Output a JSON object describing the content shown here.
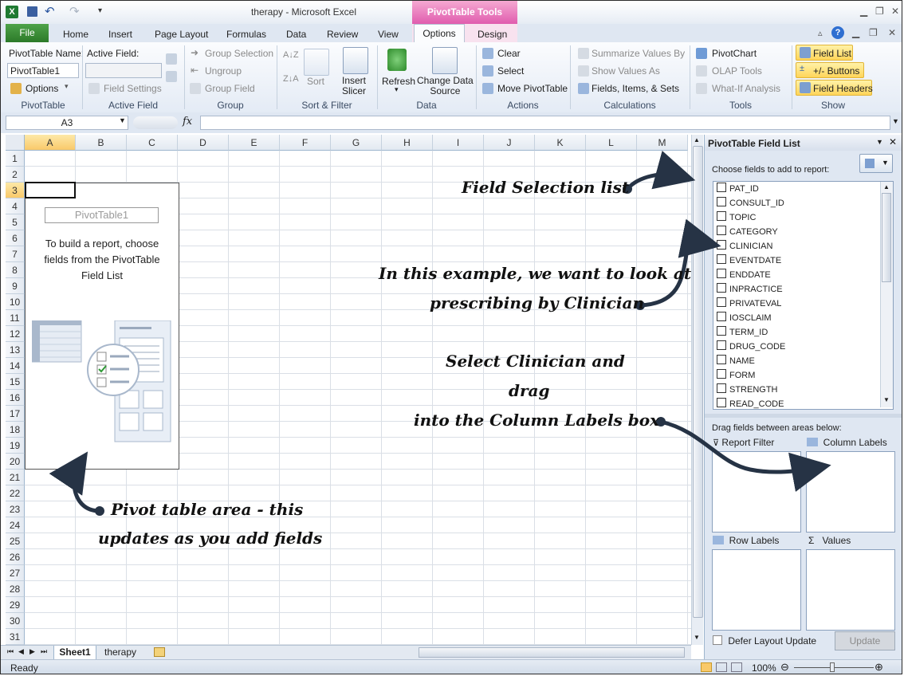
{
  "window": {
    "title": "therapy -  Microsoft Excel",
    "contextual_header": "PivotTable Tools"
  },
  "tabs": {
    "file": "File",
    "home": "Home",
    "insert": "Insert",
    "page_layout": "Page Layout",
    "formulas": "Formulas",
    "data": "Data",
    "review": "Review",
    "view": "View",
    "options": "Options",
    "design": "Design"
  },
  "ribbon": {
    "pivottable": {
      "name_label": "PivotTable Name:",
      "name_value": "PivotTable1",
      "options": "Options",
      "group": "PivotTable"
    },
    "active_field": {
      "label": "Active Field:",
      "field_settings": "Field Settings",
      "group": "Active Field"
    },
    "group": {
      "selection": "Group Selection",
      "ungroup": "Ungroup",
      "group_field": "Group Field",
      "group": "Group"
    },
    "sort_filter": {
      "sort": "Sort",
      "insert_slicer": "Insert\nSlicer",
      "group": "Sort & Filter"
    },
    "data": {
      "refresh": "Refresh",
      "change_source": "Change Data\nSource",
      "group": "Data"
    },
    "actions": {
      "clear": "Clear",
      "select": "Select",
      "move": "Move PivotTable",
      "group": "Actions"
    },
    "calculations": {
      "summarize": "Summarize Values By",
      "show_values": "Show Values As",
      "fields_items": "Fields, Items, & Sets",
      "group": "Calculations"
    },
    "tools": {
      "pivotchart": "PivotChart",
      "olap": "OLAP Tools",
      "whatif": "What-If Analysis",
      "group": "Tools"
    },
    "show": {
      "field_list": "Field List",
      "buttons": "+/- Buttons",
      "headers": "Field Headers",
      "group": "Show"
    }
  },
  "formula_bar": {
    "name_box": "A3",
    "fx": "fx",
    "value": ""
  },
  "grid": {
    "columns": [
      "A",
      "B",
      "C",
      "D",
      "E",
      "F",
      "G",
      "H",
      "I",
      "J",
      "K",
      "L",
      "M"
    ],
    "rows": [
      "1",
      "2",
      "3",
      "4",
      "5",
      "6",
      "7",
      "8",
      "9",
      "10",
      "11",
      "12",
      "13",
      "14",
      "15",
      "16",
      "17",
      "18",
      "19",
      "20",
      "21",
      "22",
      "23",
      "24",
      "25",
      "26",
      "27",
      "28",
      "29",
      "30",
      "31"
    ],
    "selected_cell": "A3"
  },
  "pivot_placeholder": {
    "name": "PivotTable1",
    "instructions": "To build a report, choose fields from the PivotTable Field List"
  },
  "sheets": [
    "Sheet1",
    "therapy"
  ],
  "status": {
    "ready": "Ready",
    "zoom": "100%"
  },
  "field_list": {
    "title": "PivotTable Field List",
    "choose_label": "Choose fields to add to report:",
    "fields": [
      "PAT_ID",
      "CONSULT_ID",
      "TOPIC",
      "CATEGORY",
      "CLINICIAN",
      "EVENTDATE",
      "ENDDATE",
      "INPRACTICE",
      "PRIVATEVAL",
      "IOSCLAIM",
      "TERM_ID",
      "DRUG_CODE",
      "NAME",
      "FORM",
      "STRENGTH",
      "READ_CODE"
    ],
    "drag_label": "Drag fields between areas below:",
    "report_filter": "Report Filter",
    "column_labels": "Column Labels",
    "row_labels": "Row Labels",
    "values": "Values",
    "defer": "Defer Layout Update",
    "update": "Update"
  },
  "annotations": {
    "field_selection": "Field Selection list",
    "example_line1": "In this example, we want to look at",
    "example_line2": "prescribing by Clinician",
    "select_line1": "Select Clinician and",
    "select_line2": "drag",
    "select_line3": "into the Column Labels box",
    "pivot_line1": "Pivot table area - this",
    "pivot_line2": "updates as you add fields"
  }
}
